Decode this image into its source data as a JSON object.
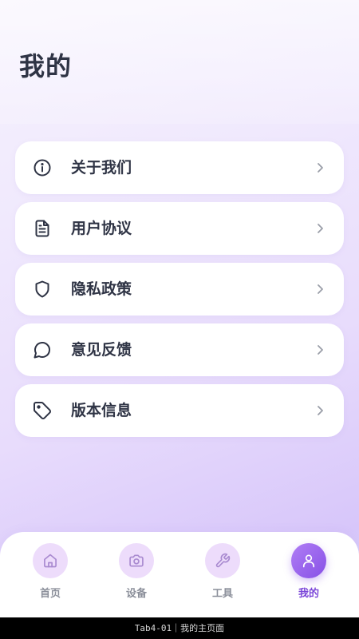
{
  "page": {
    "title": "我的"
  },
  "menu": {
    "items": [
      {
        "label": "关于我们",
        "icon": "info-icon"
      },
      {
        "label": "用户协议",
        "icon": "document-icon"
      },
      {
        "label": "隐私政策",
        "icon": "shield-icon"
      },
      {
        "label": "意见反馈",
        "icon": "chat-bubble-icon"
      },
      {
        "label": "版本信息",
        "icon": "tag-icon"
      }
    ]
  },
  "tabbar": {
    "tabs": [
      {
        "label": "首页",
        "icon": "home-icon",
        "active": false
      },
      {
        "label": "设备",
        "icon": "camera-icon",
        "active": false
      },
      {
        "label": "工具",
        "icon": "wrench-icon",
        "active": false
      },
      {
        "label": "我的",
        "icon": "user-icon",
        "active": true
      }
    ]
  },
  "caption": {
    "text": "Tab4-01｜我的主页面"
  },
  "colors": {
    "text": "#2f3445",
    "accent": "#8750e6",
    "tab_bg": "#eddcfb",
    "inactive_label": "#8b8f9a"
  }
}
